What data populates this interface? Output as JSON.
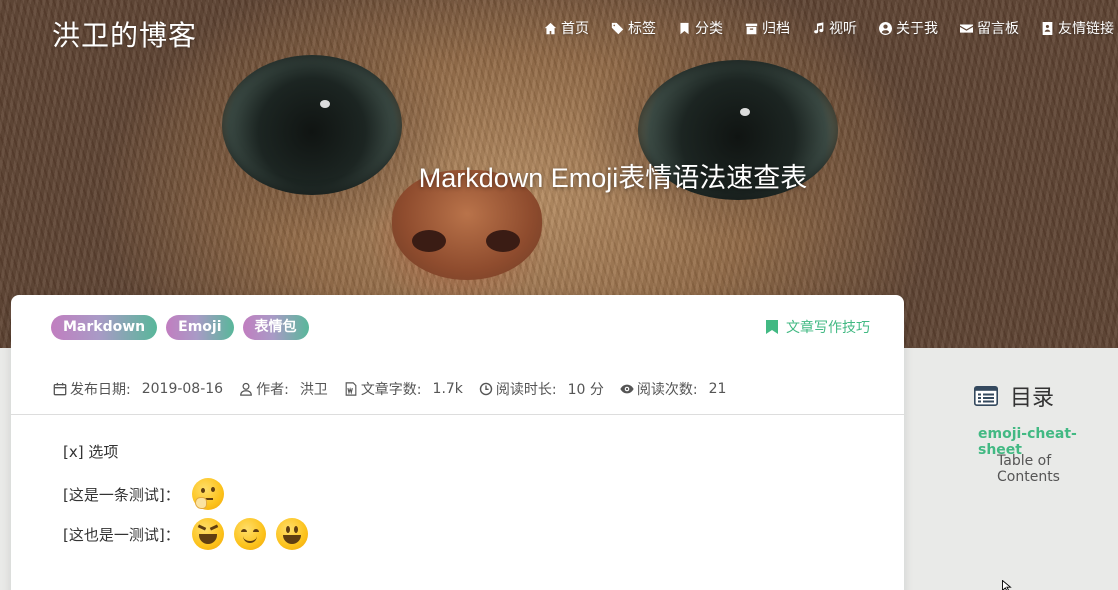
{
  "site": {
    "title": "洪卫的博客"
  },
  "nav": [
    {
      "label": "首页",
      "icon": "home-icon"
    },
    {
      "label": "标签",
      "icon": "tags-icon"
    },
    {
      "label": "分类",
      "icon": "bookmark-icon"
    },
    {
      "label": "归档",
      "icon": "archive-icon"
    },
    {
      "label": "视听",
      "icon": "music-icon"
    },
    {
      "label": "关于我",
      "icon": "user-circle-icon"
    },
    {
      "label": "留言板",
      "icon": "envelope-icon"
    },
    {
      "label": "友情链接",
      "icon": "address-book-icon"
    }
  ],
  "post": {
    "title": "Markdown Emoji表情语法速查表",
    "tags": [
      "Markdown",
      "Emoji",
      "表情包"
    ],
    "category": "文章写作技巧",
    "meta": {
      "date_label": "发布日期:",
      "date": "2019-08-16",
      "author_label": "作者:",
      "author": "洪卫",
      "words_label": "文章字数:",
      "words": "1.7k",
      "time_label": "阅读时长:",
      "time": "10 分",
      "views_label": "阅读次数:",
      "views": "21"
    },
    "content": {
      "line1": "[x] 选项",
      "line2": "[这是一条测试]：",
      "line3": "[这也是一测试]："
    }
  },
  "toc": {
    "title": "目录",
    "items": [
      "emoji-cheat-sheet",
      "Table of Contents"
    ]
  },
  "colors": {
    "accent": "#42b983",
    "tag_start": "#c17ec0",
    "tag_end": "#58b79a"
  }
}
